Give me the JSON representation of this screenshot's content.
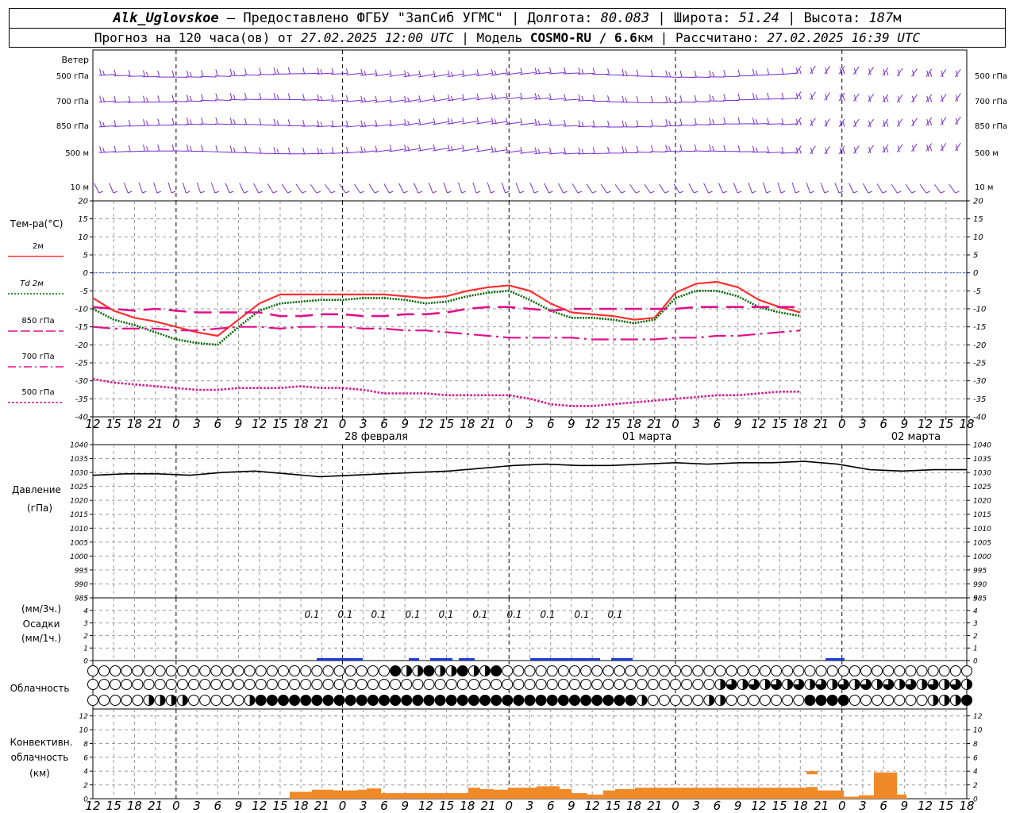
{
  "header": {
    "station": "Alk_Uglovskoe",
    "dash": " – ",
    "provider": "Предоставлено ФГБУ \"ЗапСиб УГМС\"",
    "lon_label": "Долгота: ",
    "lon_value": "80.083",
    "lat_label": "Широта: ",
    "lat_value": "51.24",
    "alt_label": "Высота: ",
    "alt_value": "187",
    "alt_unit": "м",
    "forecast_label": "Прогноз на 120 часа(ов) от ",
    "forecast_time": "27.02.2025 12:00 UTC",
    "model_label": "Модель ",
    "model_name": "COSMO-RU / 6.6",
    "model_unit": "км",
    "calc_label": "Рассчитано: ",
    "calc_time": "27.02.2025 16:39 UTC"
  },
  "panels": {
    "wind": {
      "title": "Ветер",
      "levels": [
        "500 гПа",
        "700 гПа",
        "850 гПа",
        "500 м",
        "10  м"
      ],
      "color": "#7a2fd0"
    },
    "temperature": {
      "title": "Тем-ра(°С)",
      "legend": [
        {
          "label": "2м",
          "color": "#ff3030",
          "dash": "solid"
        },
        {
          "label": "Td  2м",
          "color": "#006600",
          "dash": "dotted"
        },
        {
          "label": "850 гПа",
          "color": "#e0108a",
          "dash": "long-dash"
        },
        {
          "label": "700 гПа",
          "color": "#e0108a",
          "dash": "dash-dot"
        },
        {
          "label": "500 гПа",
          "color": "#e0108a",
          "dash": "short-dot"
        }
      ]
    },
    "pressure": {
      "title": "Давление",
      "unit": "(гПа)"
    },
    "precip": {
      "unit3": "(мм/3ч.)",
      "title": "Осадки",
      "unit1": "(мм/1ч.)"
    },
    "cloud": {
      "title": "Облачность"
    },
    "convective": {
      "title1": "Конвективн.",
      "title2": "облачность",
      "unit": "(км)"
    }
  },
  "chart_data": [
    {
      "type": "line",
      "id": "temperature",
      "x_hours": [
        0,
        3,
        6,
        9,
        12,
        15,
        18,
        21,
        24,
        27,
        30,
        33,
        36,
        39,
        42,
        45,
        48,
        51,
        54,
        57,
        60,
        63,
        66,
        69,
        72,
        75,
        78,
        81,
        84,
        87,
        90,
        93,
        96,
        99,
        102,
        105,
        108,
        111,
        114,
        117,
        120
      ],
      "x_tick_labels": [
        "12",
        "15",
        "18",
        "21",
        "0",
        "3",
        "6",
        "9",
        "12",
        "15",
        "18",
        "21",
        "0",
        "3",
        "6",
        "9",
        "12",
        "15",
        "18",
        "21",
        "0",
        "3",
        "6",
        "9",
        "12",
        "15",
        "18",
        "21",
        "0",
        "3",
        "6",
        "9",
        "12",
        "15",
        "18",
        "21",
        "0",
        "3",
        "6",
        "9",
        "12",
        "15",
        "18"
      ],
      "date_labels": [
        "28 февраля",
        "01 марта",
        "02 марта"
      ],
      "ylim": [
        -40,
        20
      ],
      "yticks": [
        20,
        15,
        10,
        5,
        0,
        -5,
        -10,
        -15,
        -20,
        -25,
        -30,
        -35,
        -40
      ],
      "series": [
        {
          "name": "2м",
          "values": [
            -7,
            -10.5,
            -12.5,
            -13.5,
            -15,
            -16.5,
            -17.5,
            -13,
            -8.5,
            -6,
            -6,
            -6,
            -6,
            -6,
            -6,
            -6.5,
            -7,
            -6.5,
            -5,
            -4,
            -3.5,
            -5,
            -8.5,
            -11,
            -11.5,
            -12,
            -13,
            -12.5,
            -5.5,
            -3,
            -2.5,
            -4,
            -7.5,
            -9.5,
            -11
          ]
        },
        {
          "name": "Td  2м",
          "values": [
            -10,
            -13,
            -14.5,
            -16.5,
            -18.5,
            -19.5,
            -20,
            -15,
            -10.5,
            -8.5,
            -8,
            -7.5,
            -7.5,
            -7,
            -7,
            -7.5,
            -8.5,
            -8,
            -6.5,
            -5.5,
            -5,
            -7.5,
            -10.5,
            -12.5,
            -12.5,
            -13,
            -14,
            -13,
            -7,
            -5,
            -5,
            -6.5,
            -9.5,
            -11,
            -12
          ]
        },
        {
          "name": "850 гПа",
          "values": [
            -9.5,
            -10,
            -10.5,
            -10,
            -10.5,
            -11,
            -11,
            -11,
            -11,
            -12,
            -12,
            -11.5,
            -11.5,
            -12,
            -12,
            -11.5,
            -11.5,
            -11,
            -10,
            -9.5,
            -9.5,
            -10,
            -10.5,
            -10,
            -10,
            -10,
            -10,
            -10,
            -10,
            -9.5,
            -9.5,
            -9.5,
            -9.5,
            -9.5,
            -9.5
          ]
        },
        {
          "name": "700 гПа",
          "values": [
            -15,
            -15.5,
            -15.5,
            -15.5,
            -16,
            -16,
            -15.5,
            -15,
            -15,
            -15.5,
            -15,
            -15,
            -15,
            -15.5,
            -15.5,
            -16,
            -16,
            -16.5,
            -17,
            -17.5,
            -18,
            -18,
            -18,
            -18,
            -18.5,
            -18.5,
            -18.5,
            -18.5,
            -18,
            -18,
            -17.5,
            -17.5,
            -17,
            -16.5,
            -16
          ]
        },
        {
          "name": "500 гПа",
          "values": [
            -29.5,
            -30.5,
            -31,
            -31.5,
            -32,
            -32.5,
            -32.5,
            -32,
            -32,
            -32,
            -31.5,
            -32,
            -32,
            -32.5,
            -33.5,
            -33.5,
            -33.5,
            -34,
            -34,
            -34,
            -34,
            -35,
            -36.5,
            -37,
            -37,
            -36.5,
            -36,
            -35.5,
            -35,
            -34.5,
            -34,
            -34,
            -33.5,
            -33,
            -33
          ]
        }
      ]
    },
    {
      "type": "line",
      "id": "pressure",
      "ylim": [
        985,
        1040
      ],
      "yticks": [
        1040,
        1035,
        1030,
        1025,
        1020,
        1015,
        1010,
        1005,
        1000,
        995,
        990,
        985
      ],
      "series": [
        {
          "name": "",
          "values": [
            1029,
            1029.5,
            1029.5,
            1029,
            1030,
            1030.5,
            1029.5,
            1028.5,
            1029,
            1029.5,
            1030,
            1030.5,
            1031.5,
            1032.5,
            1033,
            1032.5,
            1032.5,
            1033,
            1033.5,
            1033,
            1033.5,
            1033.5,
            1034,
            1033,
            1031,
            1030.5,
            1031,
            1031
          ]
        }
      ]
    },
    {
      "type": "bar",
      "id": "precip",
      "ylim": [
        0,
        5
      ],
      "yticks": [
        5,
        4,
        3,
        2,
        1,
        0
      ],
      "labels_3h": [
        "0.1",
        "0.1",
        "0.1",
        "0.1",
        "0.1",
        "0.1",
        "0.1",
        "0.1",
        "0.1",
        "0.1"
      ],
      "series": [
        {
          "name": "",
          "values": [
            0.1,
            0.1,
            0.1,
            0.1,
            0.1,
            0.1,
            0.1,
            0.1,
            0.1,
            0.1
          ]
        }
      ]
    },
    {
      "type": "bar",
      "id": "convective",
      "ylim": [
        0,
        13
      ],
      "yticks": [
        12,
        10,
        8,
        6,
        4,
        2,
        0
      ],
      "series": [
        {
          "name": "",
          "values": [
            1,
            1.3,
            1.2,
            1.3,
            1.5,
            0.8,
            1.6,
            1.4,
            1.3,
            1.6,
            1.8,
            1.4,
            0.8,
            0.6,
            1.2,
            1.4,
            1.4,
            1.6,
            1.7,
            1.2,
            0.3,
            0.5,
            3.8,
            0.6,
            0.9,
            1.2
          ]
        }
      ]
    }
  ]
}
